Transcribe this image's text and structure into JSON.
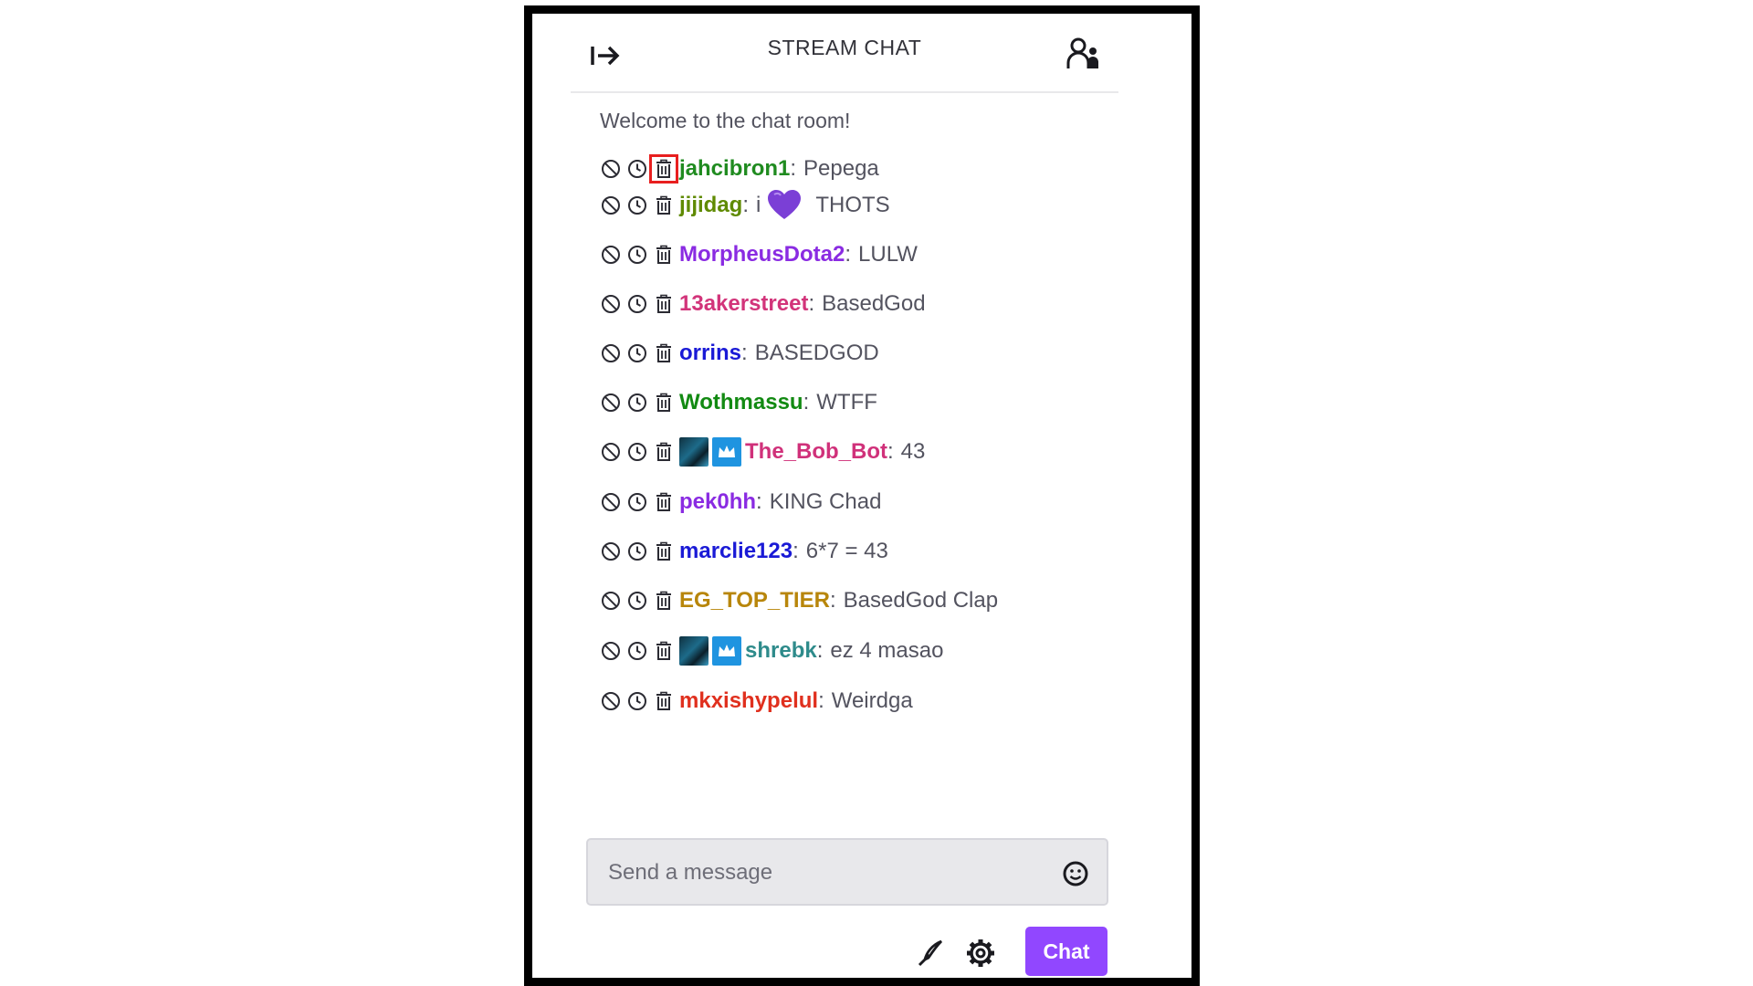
{
  "header": {
    "title": "STREAM CHAT"
  },
  "welcome": "Welcome to the chat room!",
  "highlight_color": "#e81f1f",
  "messages": [
    {
      "user": "jahcibron1",
      "color": "#1f8b1f",
      "text": "Pepega",
      "badges": [],
      "highlight_delete": true
    },
    {
      "user": "jijidag",
      "color": "#5f8a00",
      "text_before": "i",
      "emote": "purple-heart",
      "text": "THOTS",
      "badges": []
    },
    {
      "user": "MorpheusDota2",
      "color": "#8a2be2",
      "text": "LULW",
      "badges": []
    },
    {
      "user": "13akerstreet",
      "color": "#d2347a",
      "text": "BasedGod",
      "badges": []
    },
    {
      "user": "orrins",
      "color": "#1a1ad6",
      "text": "BASEDGOD",
      "badges": []
    },
    {
      "user": "Wothmassu",
      "color": "#128a12",
      "text": "WTFF",
      "badges": []
    },
    {
      "user": "The_Bob_Bot",
      "color": "#d0317a",
      "text": "43",
      "badges": [
        "avatar-badge",
        "crown-badge"
      ]
    },
    {
      "user": "pek0hh",
      "color": "#8a2be2",
      "text": "KING Chad",
      "badges": []
    },
    {
      "user": "marclie123",
      "color": "#1a1ad6",
      "text": "6*7 = 43",
      "badges": []
    },
    {
      "user": "EG_TOP_TIER",
      "color": "#b8860b",
      "text": "BasedGod Clap",
      "badges": []
    },
    {
      "user": "shrebk",
      "color": "#2e8b8b",
      "text": "ez 4 masao",
      "badges": [
        "avatar-badge",
        "crown-badge"
      ]
    },
    {
      "user": "mkxishypelul",
      "color": "#e0301e",
      "text": "Weirdga",
      "badges": []
    }
  ],
  "input": {
    "placeholder": "Send a message"
  },
  "actions": {
    "chat_label": "Chat"
  },
  "colors": {
    "accent": "#9147ff",
    "border": "#000000"
  }
}
